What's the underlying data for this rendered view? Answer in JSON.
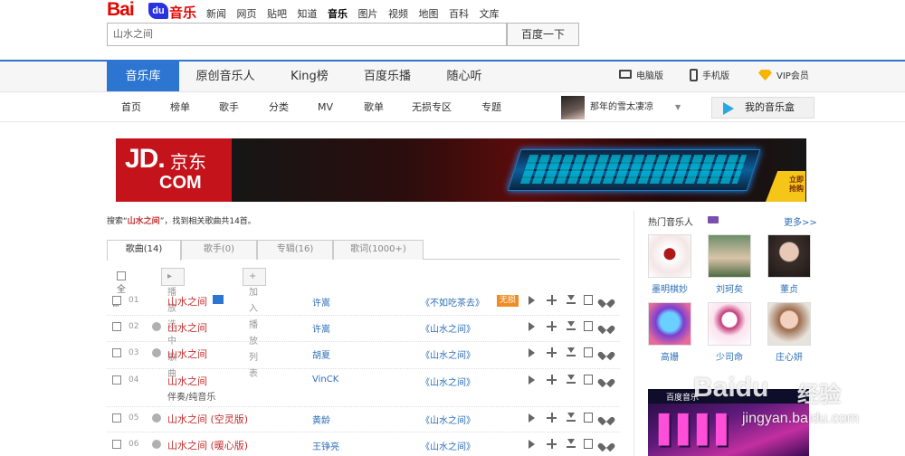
{
  "logo": {
    "text_bai": "Bai",
    "text_du": "du",
    "text_music": "音乐"
  },
  "top_nav": [
    "新闻",
    "网页",
    "贴吧",
    "知道",
    "音乐",
    "图片",
    "视频",
    "地图",
    "百科",
    "文库"
  ],
  "top_nav_current": "音乐",
  "search": {
    "value": "山水之间",
    "button": "百度一下"
  },
  "main_nav": {
    "tabs": [
      "音乐库",
      "原创音乐人",
      "King榜",
      "百度乐播",
      "随心听"
    ],
    "active": "音乐库",
    "right": {
      "desktop": "电脑版",
      "mobile": "手机版",
      "vip": "VIP会员"
    }
  },
  "sub_nav": [
    "首页",
    "榜单",
    "歌手",
    "分类",
    "MV",
    "歌单",
    "无损专区",
    "专题"
  ],
  "now_playing": {
    "title": "那年的雪太凄凉"
  },
  "my_music_box": "我的音乐盒",
  "banner": {
    "brand_jd": "JD.",
    "brand_cn": "京东",
    "brand_com": "COM",
    "buy": "立即抢购"
  },
  "result": {
    "prefix": "搜索“",
    "query": "山水之间",
    "suffix": "”，找到相关歌曲共14首。"
  },
  "result_tabs": [
    "歌曲(14)",
    "歌手(0)",
    "专辑(16)",
    "歌词(1000+)"
  ],
  "toolbar": {
    "select_all": "全部",
    "play_selected": "播放选中歌曲",
    "add_playlist": "加入播放列表"
  },
  "songs": [
    {
      "num": "01",
      "title": "山水之间",
      "artist": "许嵩",
      "album": "《不如吃茶去》",
      "badge": "无损",
      "sub": ""
    },
    {
      "num": "02",
      "title": "山水之间",
      "artist": "许嵩",
      "album": "《山水之间》",
      "badge": "",
      "sub": ""
    },
    {
      "num": "03",
      "title": "山水之间",
      "artist": "胡夏",
      "album": "《山水之间》",
      "badge": "",
      "sub": ""
    },
    {
      "num": "04",
      "title": "山水之间",
      "artist": "VinCK",
      "album": "《山水之间》",
      "badge": "",
      "sub": "伴奏/纯音乐"
    },
    {
      "num": "05",
      "title": "山水之间 (空灵版)",
      "artist": "黄龄",
      "album": "《山水之间》",
      "badge": "",
      "sub": ""
    },
    {
      "num": "06",
      "title": "山水之间 (暖心版)",
      "artist": "王铮亮",
      "album": "《山水之间》",
      "badge": "",
      "sub": ""
    }
  ],
  "sidebar": {
    "title": "热门音乐人",
    "more": "更多>>",
    "artists": [
      "墨明棋妙",
      "刘珂矣",
      "董贞",
      "高姗",
      "少司命",
      "庄心妍"
    ]
  },
  "side_ad": {
    "header": "百度音乐"
  },
  "watermark": {
    "brand": "Baidu",
    "cn": "经验",
    "url": "jingyan.baidu.com"
  },
  "colors": {
    "accent": "#2c76d2",
    "song_title": "#c62f2f",
    "link": "#2c6fb8",
    "lossless_badge": "#f08c26",
    "logo_red": "#e10602"
  }
}
